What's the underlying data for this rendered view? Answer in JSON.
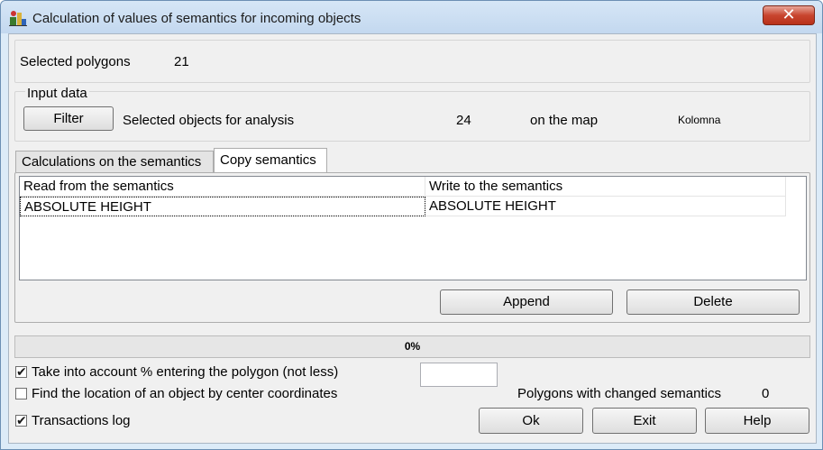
{
  "window": {
    "title": "Calculation of values of semantics for incoming objects",
    "close_label": "✕"
  },
  "selected_polygons": {
    "label": "Selected polygons",
    "value": "21"
  },
  "input_data": {
    "group_label": "Input data",
    "filter_label": "Filter",
    "objects_label": "Selected objects for analysis",
    "objects_count": "24",
    "on_map_label": "on the map",
    "map_name": "Kolomna"
  },
  "tabs": [
    {
      "label": "Calculations on the semantics",
      "active": false
    },
    {
      "label": "Copy semantics",
      "active": true
    }
  ],
  "grid": {
    "columns": [
      "Read from the semantics",
      "Write to the semantics"
    ],
    "rows": [
      [
        "ABSOLUTE HEIGHT",
        "ABSOLUTE HEIGHT"
      ]
    ]
  },
  "grid_buttons": {
    "append_label": "Append",
    "delete_label": "Delete"
  },
  "progress": {
    "value": 0,
    "text": "0%"
  },
  "options": {
    "take_account": {
      "label": "Take into account % entering the polygon (not less)",
      "checked": true,
      "value": ""
    },
    "find_location": {
      "label": "Find the location of an object by center coordinates",
      "checked": false
    },
    "transactions_log": {
      "label": "Transactions log",
      "checked": true
    }
  },
  "changed": {
    "label": "Polygons with changed semantics",
    "value": "0"
  },
  "footer": {
    "ok_label": "Ok",
    "exit_label": "Exit",
    "help_label": "Help"
  },
  "colors": {
    "progress_fill": "#06b025",
    "close_button": "#c8452f",
    "titlebar": "#c3d8ef"
  },
  "icons": {
    "app": "app-icon",
    "close": "close-icon",
    "check": "check-icon"
  }
}
